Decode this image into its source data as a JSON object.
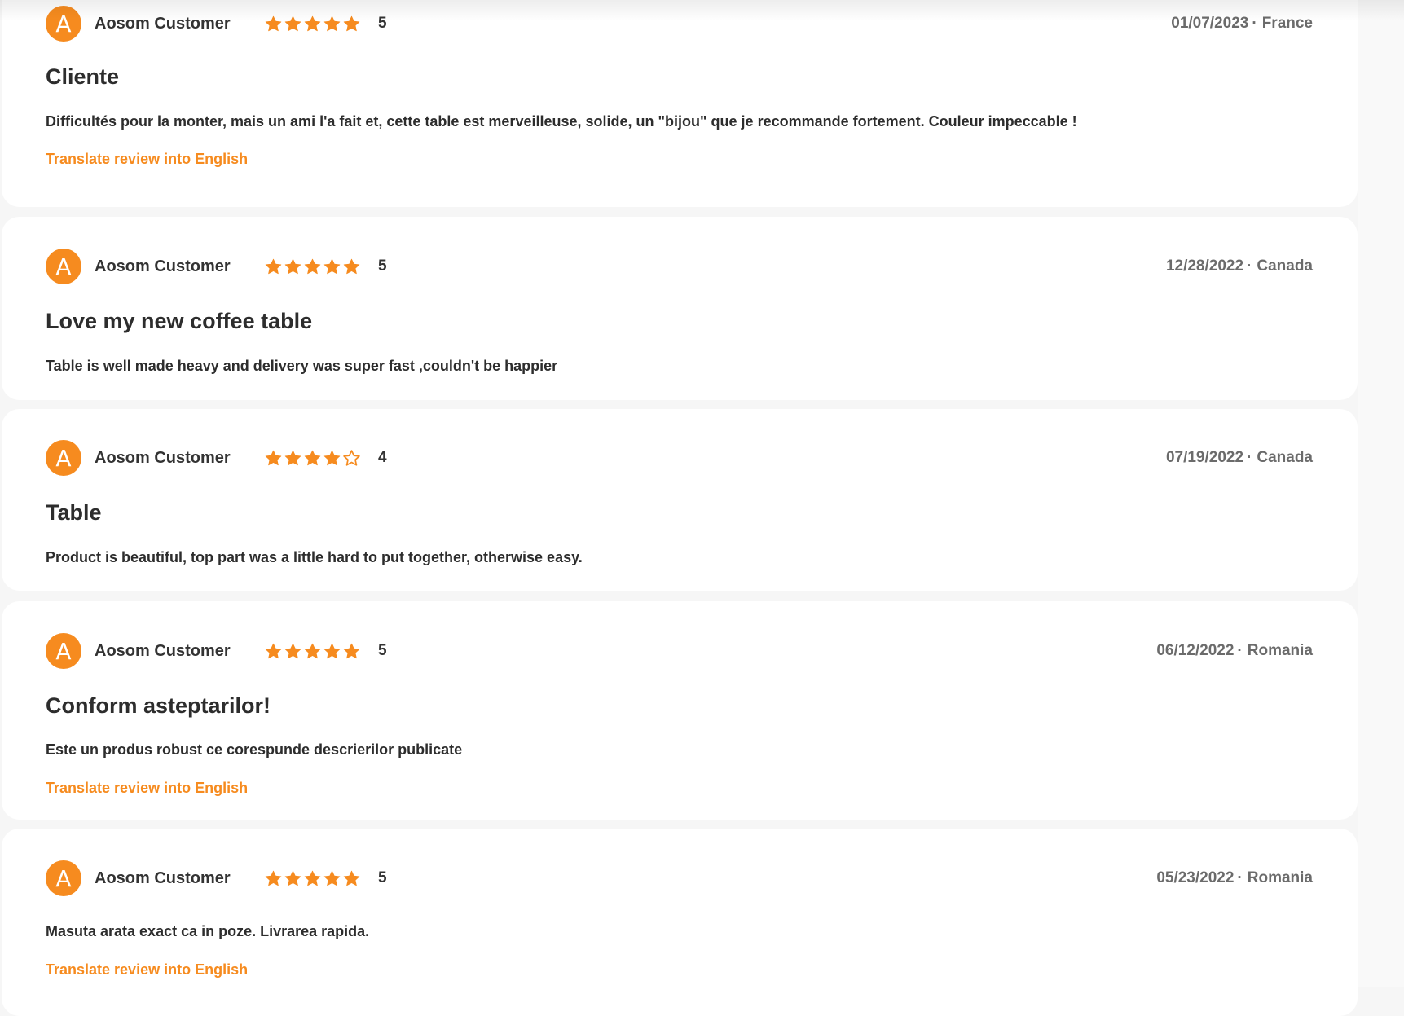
{
  "accent_color": "#f68b1f",
  "reviews": [
    {
      "avatar_letter": "A",
      "author": "Aosom Customer",
      "rating": 5,
      "rating_label": "5",
      "date": "01/07/2023",
      "separator": "·",
      "country": "France",
      "title": "Cliente",
      "body": "Difficultés pour la monter, mais un ami l'a fait et, cette table est merveilleuse, solide, un \"bijou\" que je recommande fortement. Couleur impeccable !",
      "translate_label": "Translate review into English"
    },
    {
      "avatar_letter": "A",
      "author": "Aosom Customer",
      "rating": 5,
      "rating_label": "5",
      "date": "12/28/2022",
      "separator": "·",
      "country": "Canada",
      "title": "Love my new coffee table",
      "body": "Table is well made heavy and delivery was super fast ,couldn't be happier",
      "translate_label": ""
    },
    {
      "avatar_letter": "A",
      "author": "Aosom Customer",
      "rating": 4,
      "rating_label": "4",
      "date": "07/19/2022",
      "separator": "·",
      "country": "Canada",
      "title": "Table",
      "body": "Product is beautiful, top part was a little hard to put together, otherwise easy.",
      "translate_label": ""
    },
    {
      "avatar_letter": "A",
      "author": "Aosom Customer",
      "rating": 5,
      "rating_label": "5",
      "date": "06/12/2022",
      "separator": "·",
      "country": "Romania",
      "title": "Conform asteptarilor!",
      "body": "Este un produs robust ce corespunde descrierilor publicate",
      "translate_label": "Translate review into English"
    },
    {
      "avatar_letter": "A",
      "author": "Aosom Customer",
      "rating": 5,
      "rating_label": "5",
      "date": "05/23/2022",
      "separator": "·",
      "country": "Romania",
      "title": "",
      "body": "Masuta arata exact ca in poze. Livrarea rapida.",
      "translate_label": "Translate review into English"
    }
  ]
}
